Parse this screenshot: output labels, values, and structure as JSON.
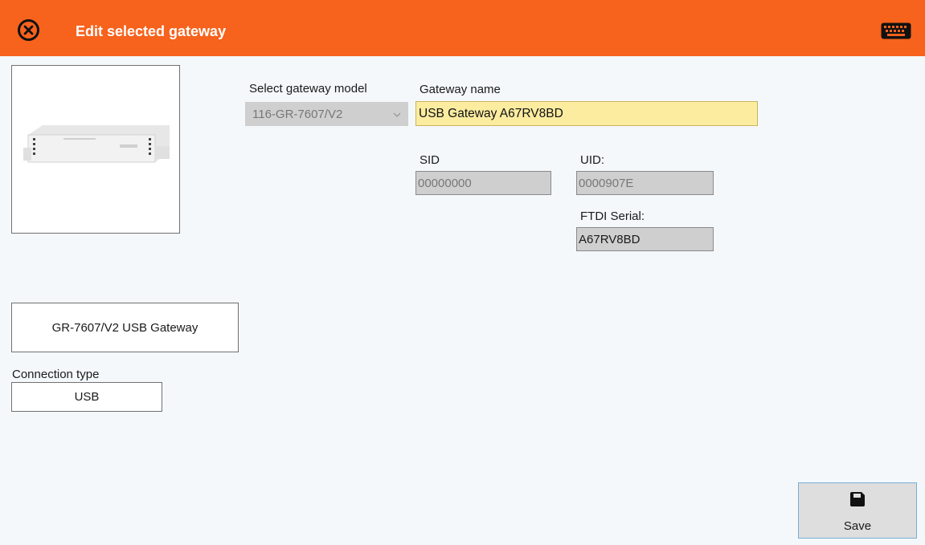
{
  "header": {
    "title": "Edit selected gateway",
    "close_icon": "close-circle-icon",
    "keyboard_icon": "keyboard-icon",
    "background": "#f7621c"
  },
  "form": {
    "model_label": "Select gateway model",
    "model_value": "116-GR-7607/V2",
    "name_label": "Gateway name",
    "name_value": "USB Gateway A67RV8BD",
    "sid_label": "SID",
    "sid_value": "00000000",
    "uid_label": "UID:",
    "uid_value": "0000907E",
    "ftdi_label": "FTDI Serial:",
    "ftdi_value": "A67RV8BD"
  },
  "left": {
    "model_name": "GR-7607/V2 USB Gateway",
    "connection_label": "Connection type",
    "connection_value": "USB"
  },
  "actions": {
    "save_label": "Save",
    "save_icon": "floppy-disk-icon"
  }
}
